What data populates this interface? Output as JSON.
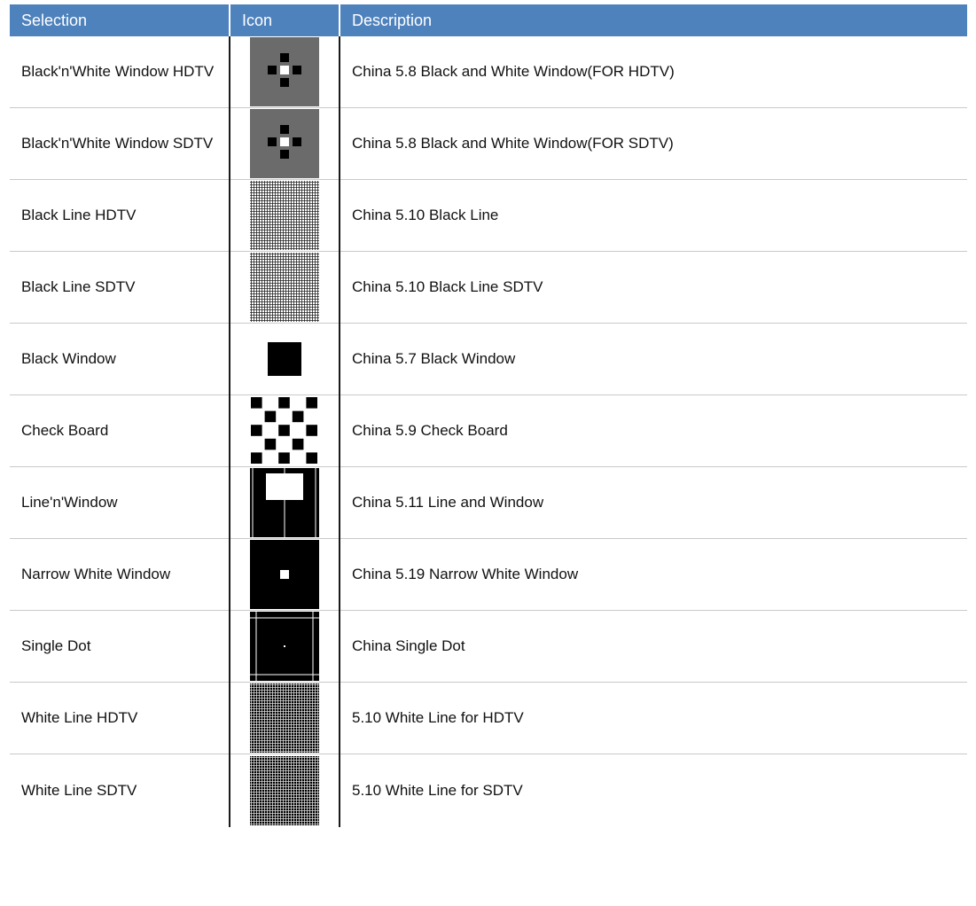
{
  "headers": {
    "selection": "Selection",
    "icon": "Icon",
    "description": "Description"
  },
  "colors": {
    "header_bg": "#4e82bd",
    "header_text": "#ffffff"
  },
  "rows": [
    {
      "selection": "Black'n'White Window HDTV",
      "icon": "bw-window-pattern-icon",
      "description": "China 5.8 Black and White Window(FOR HDTV)"
    },
    {
      "selection": "Black'n'White Window SDTV",
      "icon": "bw-window-pattern-icon",
      "description": "China 5.8 Black and White Window(FOR SDTV)"
    },
    {
      "selection": "Black Line HDTV",
      "icon": "black-line-grid-icon",
      "description": "China 5.10 Black Line"
    },
    {
      "selection": "Black Line SDTV",
      "icon": "black-line-grid-icon",
      "description": "China 5.10 Black Line SDTV"
    },
    {
      "selection": "Black Window",
      "icon": "black-window-icon",
      "description": "China 5.7 Black Window"
    },
    {
      "selection": "Check Board",
      "icon": "checkerboard-icon",
      "description": "China 5.9 Check Board"
    },
    {
      "selection": "Line'n'Window",
      "icon": "line-and-window-icon",
      "description": "China 5.11 Line and Window"
    },
    {
      "selection": "Narrow White Window",
      "icon": "narrow-white-window-icon",
      "description": "China 5.19 Narrow White Window"
    },
    {
      "selection": "Single Dot",
      "icon": "single-dot-icon",
      "description": "China Single Dot"
    },
    {
      "selection": "White Line HDTV",
      "icon": "white-line-grid-icon",
      "description": "5.10 White Line for HDTV"
    },
    {
      "selection": "White Line SDTV",
      "icon": "white-line-grid-icon",
      "description": "5.10 White Line for SDTV"
    }
  ]
}
